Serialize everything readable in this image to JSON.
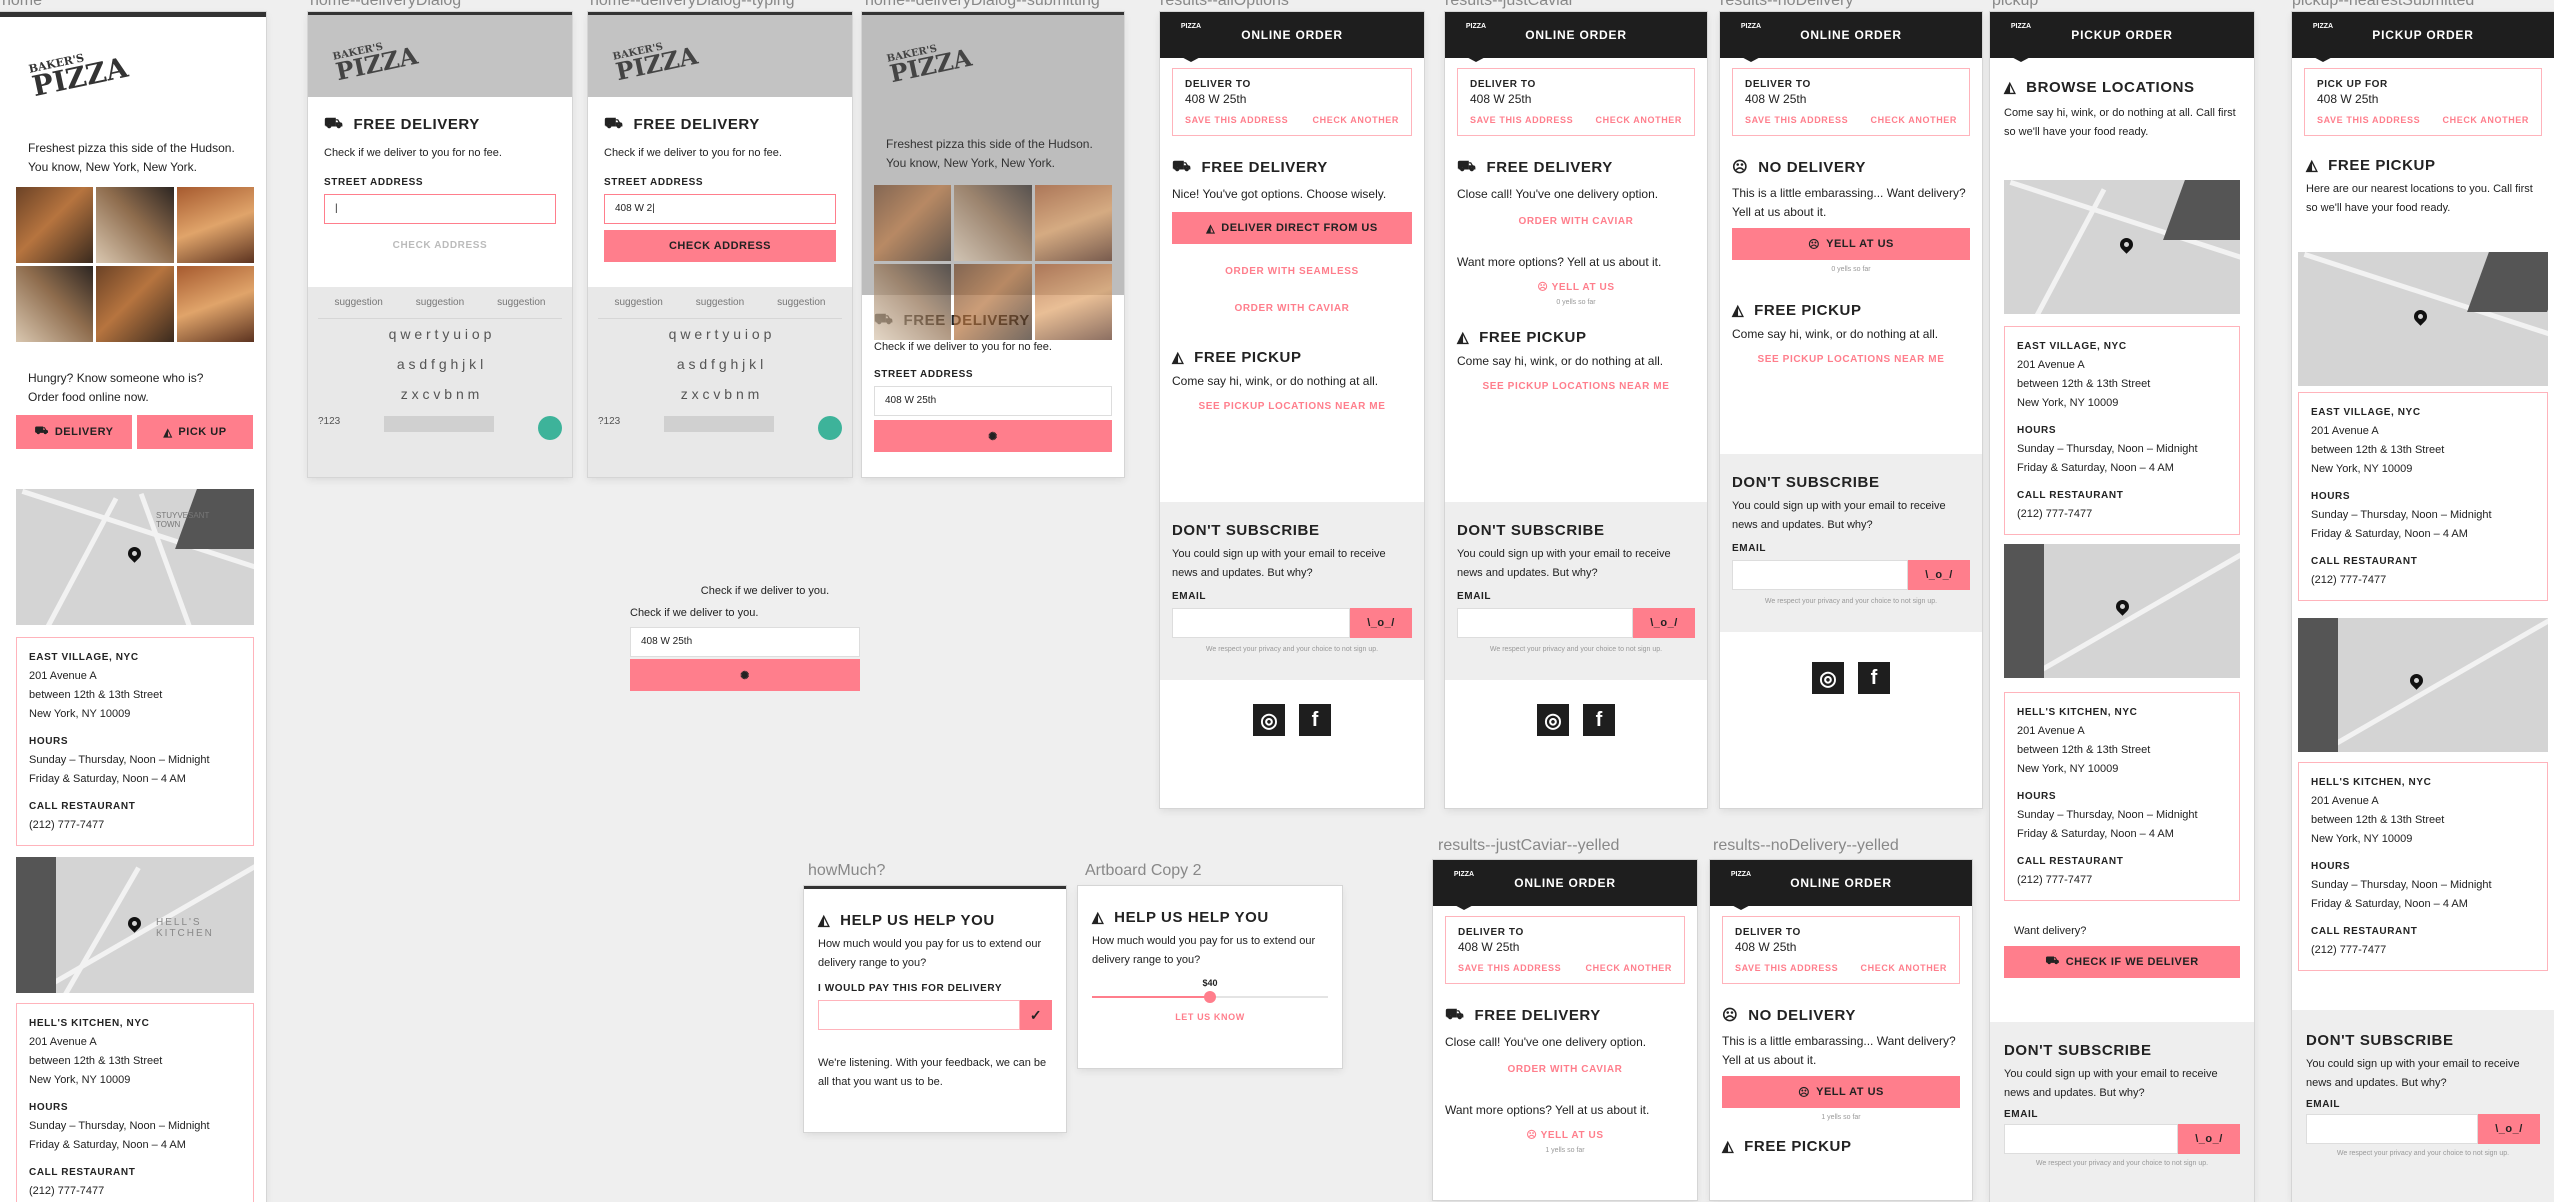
{
  "artboard_labels": {
    "home": "home",
    "dialog": "home--deliveryDialog",
    "typing": "home--deliveryDialog--typing",
    "submitting": "home--deliveryDialog--submitting",
    "allOptions": "results--allOptions",
    "justCaviar": "results--justCaviar",
    "noDelivery": "results--noDelivery",
    "pickup": "pickup",
    "nearestPickup": "pickup--nearestSubmitted",
    "howMuch": "howMuch?",
    "copy2": "Artboard Copy 2",
    "justCaviarYelled": "results--justCaviar--yelled",
    "noDeliveryYelled": "results--noDelivery--yelled"
  },
  "brand": {
    "line1": "BAKER'S",
    "line2": "PIZZA",
    "accent": "#ff7e8c",
    "dark": "#1e1e1e"
  },
  "home": {
    "tagline": "Freshest pizza this side of the Hudson. You know, New York, New York.",
    "hungry": "Hungry? Know someone who is? Order food online now.",
    "delivery": "DELIVERY",
    "pickup": "PICK UP"
  },
  "locations": [
    {
      "name": "EAST VILLAGE, NYC",
      "addr1": "201 Avenue A",
      "addr2": "between 12th & 13th Street",
      "addr3": "New York, NY 10009",
      "hours_label": "HOURS",
      "hours1": "Sunday – Thursday, Noon – Midnight",
      "hours2": "Friday & Saturday, Noon – 4 AM",
      "call_label": "CALL RESTAURANT",
      "phone": "(212) 777-7477",
      "map_label": "STUYVESANT TOWN"
    },
    {
      "name": "HELL'S KITCHEN, NYC",
      "addr1": "201 Avenue A",
      "addr2": "between 12th & 13th Street",
      "addr3": "New York, NY 10009",
      "hours_label": "HOURS",
      "hours1": "Sunday – Thursday, Noon – Midnight",
      "hours2": "Friday & Saturday, Noon – 4 AM",
      "call_label": "CALL RESTAURANT",
      "phone": "(212) 777-7477",
      "map_label": "HELL'S KITCHEN"
    }
  ],
  "dialog": {
    "title": "FREE DELIVERY",
    "sub": "Check if we deliver to you for no fee.",
    "label": "STREET ADDRESS",
    "value_typing": "408 W 2|",
    "value": "408 W 25th",
    "check": "CHECK ADDRESS",
    "suggestions": [
      "suggestion",
      "suggestion",
      "suggestion"
    ],
    "rows": [
      "q w e r t y u i o p",
      "a s d f g h j k l",
      "z x c v b n m"
    ],
    "num": "?123"
  },
  "floating": {
    "line1": "Check if we deliver to you.",
    "line2": "Check if we deliver to you.",
    "value": "408 W 25th"
  },
  "results": {
    "header": "ONLINE ORDER",
    "deliver_to": "DELIVER TO",
    "address": "408 W 25th",
    "save": "SAVE THIS ADDRESS",
    "another": "CHECK ANOTHER",
    "free_delivery": "FREE DELIVERY",
    "nice": "Nice! You've got options. Choose wisely.",
    "direct": "DELIVER DIRECT FROM US",
    "seamless": "ORDER WITH SEAMLESS",
    "caviar": "ORDER WITH CAVIAR",
    "close_call": "Close call! You've one delivery option.",
    "more": "Want more options? Yell at us about it.",
    "yell": "YELL AT US",
    "yells": "0 yells so far",
    "yells_after": "1 yells so far",
    "no_delivery": "NO DELIVERY",
    "embarrassing": "This is a little embarassing... Want delivery? Yell at us about it.",
    "free_pickup": "FREE PICKUP",
    "pickup_sub": "Come say hi, wink, or do nothing at all.",
    "see_pickup": "SEE PICKUP LOCATIONS NEAR ME",
    "dont_sub": "DON'T SUBSCRIBE",
    "sub_text": "You could sign up with your email to receive news and updates. But why?",
    "email": "EMAIL",
    "privacy": "We respect your privacy and your choice to not sign up.",
    "submit": "\\_o_/"
  },
  "pickup": {
    "header": "PICKUP ORDER",
    "browse": "BROWSE LOCATIONS",
    "browse_sub": "Come say hi, wink, or do nothing at all. Call first so we'll have your food ready.",
    "want": "Want delivery?",
    "check": "CHECK IF WE DELIVER",
    "pickup_for": "PICK UP FOR",
    "nearest_title": "FREE PICKUP",
    "nearest_sub": "Here are our nearest locations to you. Call first so we'll have your food ready."
  },
  "howmuch": {
    "title": "HELP US HELP YOU",
    "sub": "How much would you pay for us to extend our delivery range to you?",
    "label": "I WOULD PAY THIS FOR DELIVERY",
    "listening": "We're listening. With your feedback, we can be all that you want us to be.",
    "amount": "$40",
    "letknow": "LET US KNOW",
    "slider_fraction": 0.5
  }
}
